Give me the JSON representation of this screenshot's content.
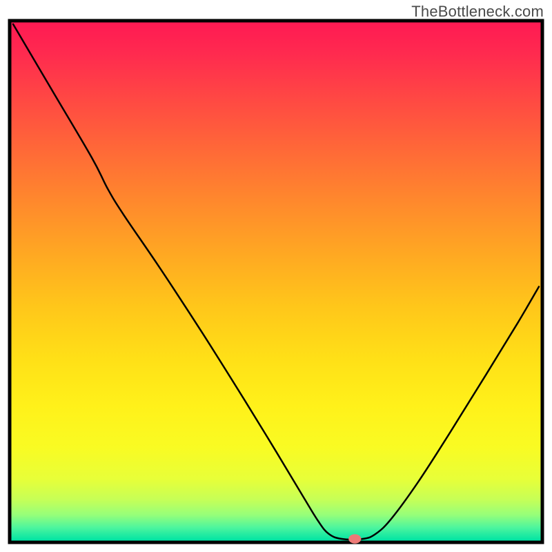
{
  "watermark": "TheBottleneck.com",
  "chart_data": {
    "type": "line",
    "title": "",
    "xlabel": "",
    "ylabel": "",
    "xlim": [
      0,
      100
    ],
    "ylim": [
      0,
      100
    ],
    "background_gradient_stops": [
      {
        "offset": 0.0,
        "color": "#ff1a53"
      },
      {
        "offset": 0.06,
        "color": "#ff2a4f"
      },
      {
        "offset": 0.15,
        "color": "#ff4943"
      },
      {
        "offset": 0.25,
        "color": "#ff6a37"
      },
      {
        "offset": 0.35,
        "color": "#ff8a2c"
      },
      {
        "offset": 0.45,
        "color": "#ffa922"
      },
      {
        "offset": 0.55,
        "color": "#ffc71a"
      },
      {
        "offset": 0.65,
        "color": "#ffe017"
      },
      {
        "offset": 0.74,
        "color": "#fff11a"
      },
      {
        "offset": 0.82,
        "color": "#f9fb23"
      },
      {
        "offset": 0.88,
        "color": "#e8ff38"
      },
      {
        "offset": 0.92,
        "color": "#c7ff56"
      },
      {
        "offset": 0.95,
        "color": "#97ff79"
      },
      {
        "offset": 0.975,
        "color": "#4cf59e"
      },
      {
        "offset": 1.0,
        "color": "#00e3a4"
      }
    ],
    "series": [
      {
        "name": "bottleneck-curve",
        "stroke": "#000000",
        "stroke_width": 2.5,
        "points": [
          {
            "x": 0.0,
            "y": 100.0
          },
          {
            "x": 7.5,
            "y": 87.0
          },
          {
            "x": 15.0,
            "y": 74.0
          },
          {
            "x": 18.0,
            "y": 68.0
          },
          {
            "x": 21.0,
            "y": 63.0
          },
          {
            "x": 28.0,
            "y": 52.5
          },
          {
            "x": 36.0,
            "y": 40.0
          },
          {
            "x": 44.0,
            "y": 27.0
          },
          {
            "x": 50.0,
            "y": 17.0
          },
          {
            "x": 55.0,
            "y": 8.5
          },
          {
            "x": 58.0,
            "y": 3.5
          },
          {
            "x": 60.0,
            "y": 1.0
          },
          {
            "x": 62.5,
            "y": 0.0
          },
          {
            "x": 66.5,
            "y": 0.0
          },
          {
            "x": 69.0,
            "y": 1.0
          },
          {
            "x": 72.0,
            "y": 4.0
          },
          {
            "x": 77.0,
            "y": 11.0
          },
          {
            "x": 83.0,
            "y": 20.5
          },
          {
            "x": 90.0,
            "y": 32.0
          },
          {
            "x": 96.0,
            "y": 42.0
          },
          {
            "x": 100.0,
            "y": 49.0
          }
        ]
      }
    ],
    "marker": {
      "name": "selected-point",
      "x": 65.0,
      "y": 0.0,
      "rx": 1.2,
      "ry": 0.9,
      "color": "#ed7a77"
    },
    "plot_border_color": "#000000",
    "plot_border_width": 5
  }
}
